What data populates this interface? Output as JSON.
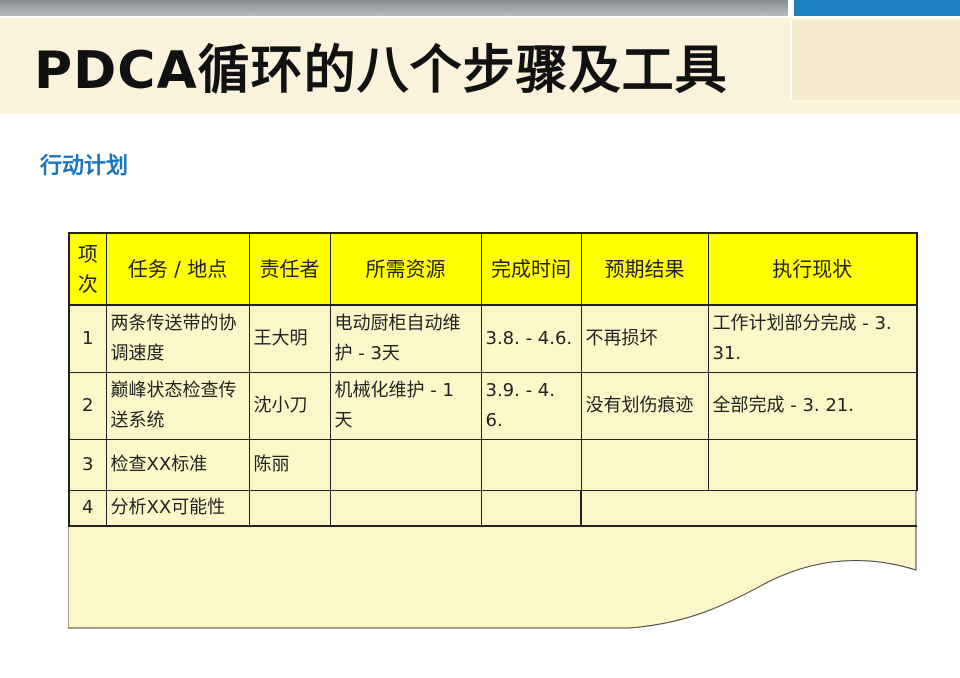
{
  "header": {
    "title": "PDCA循环的八个步骤及工具"
  },
  "section": {
    "subtitle": "行动计划"
  },
  "table": {
    "columns": [
      "项次",
      "任务 / 地点",
      "责任者",
      "所需资源",
      "完成时间",
      "预期结果",
      "执行现状"
    ],
    "rows": [
      [
        "1",
        "两条传送带的协调速度",
        "王大明",
        "电动厨柜自动维护 - 3天",
        "3.8. - 4.6.",
        "不再损坏",
        "工作计划部分完成 - 3. 31."
      ],
      [
        "2",
        "巅峰状态检查传送系统",
        "沈小刀",
        "机械化维护 - 1 天",
        "3.9. - 4. 6.",
        "没有划伤痕迹",
        "全部完成 - 3. 21."
      ],
      [
        "3",
        "检查XX标准",
        "陈丽",
        "",
        "",
        "",
        ""
      ],
      [
        "4",
        "分析XX可能性",
        "",
        "",
        "",
        "",
        ""
      ]
    ]
  },
  "colors": {
    "table_fill": "#fbf7c9",
    "header_fill": "#ffff00",
    "subtitle": "#1a74c0",
    "accent_bar": "#1e7fc1"
  }
}
